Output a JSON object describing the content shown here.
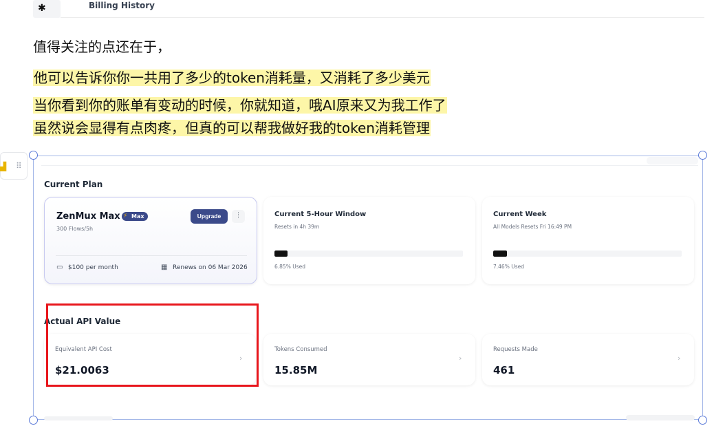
{
  "header": {
    "title": "Billing History"
  },
  "article": {
    "intro": "值得关注的点还在于，",
    "highlight_lines": [
      "他可以告诉你你一共用了多少的token消耗量，又消耗了多少美元",
      "当你看到你的账单有变动的时候，你就知道，哦AI原来又为我工作了",
      "虽然说会显得有点肉疼，但真的可以帮我做好我的token消耗管理"
    ]
  },
  "current_plan": {
    "section_title": "Current Plan",
    "plan": {
      "name": "ZenMux Max",
      "badge": "Max",
      "subtitle": "300 Flows/5h",
      "upgrade_label": "Upgrade",
      "more_label": "⋮",
      "price": "$100 per month",
      "renewal": "Renews on 06 Mar 2026"
    },
    "window": {
      "title": "Current 5-Hour Window",
      "subtitle": "Resets in 4h 39m",
      "used_percent": 6.85,
      "used_label": "6.85% Used"
    },
    "week": {
      "title": "Current Week",
      "subtitle": "All Models Resets Fri 16:49 PM",
      "used_percent": 7.46,
      "used_label": "7.46% Used"
    }
  },
  "api_value": {
    "section_title": "Actual API Value",
    "metrics": [
      {
        "label": "Equivalent API Cost",
        "value": "$21.0063"
      },
      {
        "label": "Tokens Consumed",
        "value": "15.85M"
      },
      {
        "label": "Requests Made",
        "value": "461"
      }
    ]
  },
  "colors": {
    "highlight": "#fdf6a8",
    "accent": "#3b4a8a",
    "annotation_red": "#e8161c",
    "selection_blue": "#5b7ad8"
  },
  "icons": {
    "avatar": "octopus-logo",
    "badge": "lightning-icon",
    "price": "card-icon",
    "renewal": "calendar-icon",
    "chevron": "chevron-right-icon",
    "side_tool": "image-tool-icon",
    "drag": "drag-handle-icon"
  }
}
